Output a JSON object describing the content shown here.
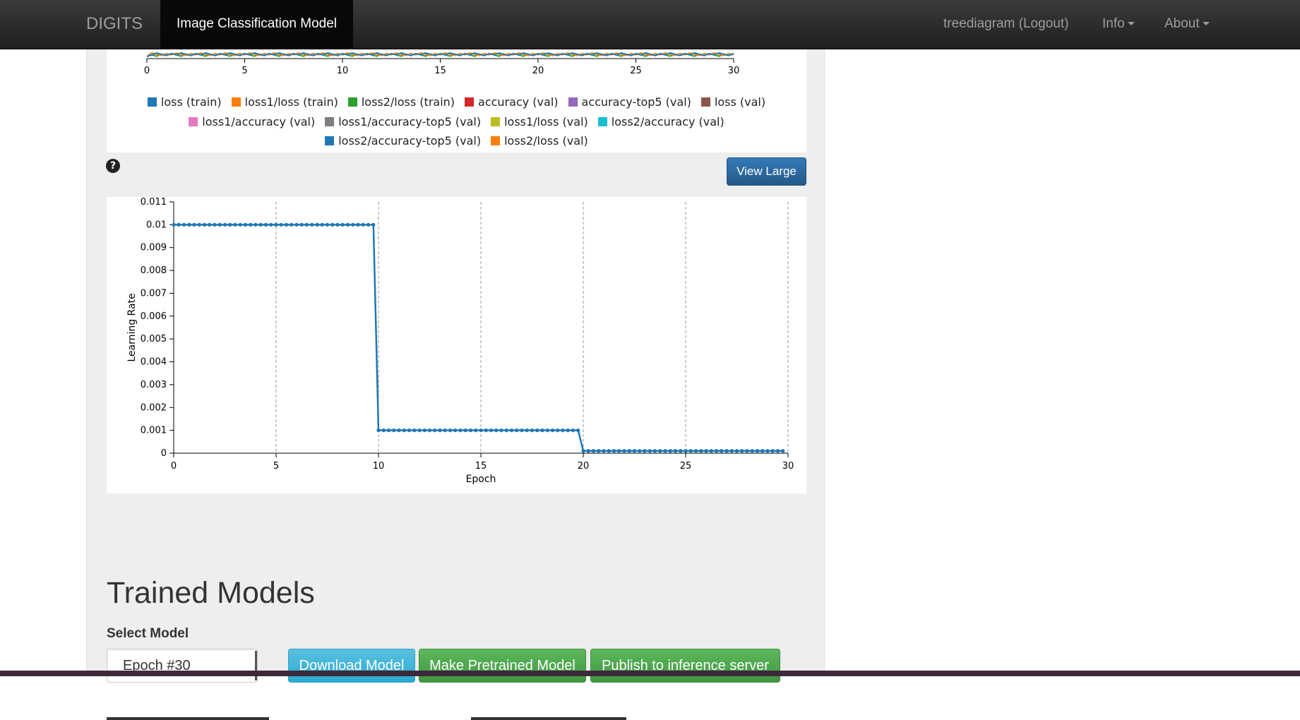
{
  "navbar": {
    "brand": "DIGITS",
    "active_tab": "Image Classification Model",
    "user": "treediagram (Logout)",
    "info": "Info",
    "about": "About"
  },
  "legend": {
    "items": [
      {
        "label": "loss (train)",
        "color": "#1f77b4"
      },
      {
        "label": "loss1/loss (train)",
        "color": "#ff7f0e"
      },
      {
        "label": "loss2/loss (train)",
        "color": "#2ca02c"
      },
      {
        "label": "accuracy (val)",
        "color": "#d62728"
      },
      {
        "label": "accuracy-top5 (val)",
        "color": "#9467bd"
      },
      {
        "label": "loss (val)",
        "color": "#8c564b"
      },
      {
        "label": "loss1/accuracy (val)",
        "color": "#e377c2"
      },
      {
        "label": "loss1/accuracy-top5 (val)",
        "color": "#7f7f7f"
      },
      {
        "label": "loss1/loss (val)",
        "color": "#bcbd22"
      },
      {
        "label": "loss2/accuracy (val)",
        "color": "#17becf"
      },
      {
        "label": "loss2/accuracy-top5 (val)",
        "color": "#1f77b4"
      },
      {
        "label": "loss2/loss (val)",
        "color": "#ff7f0e"
      }
    ]
  },
  "top_chart": {
    "x_ticks": [
      "0",
      "5",
      "10",
      "15",
      "20",
      "25",
      "30"
    ]
  },
  "help_icon": "?",
  "view_large_label": "View Large",
  "chart_data": {
    "type": "line",
    "xlabel": "Epoch",
    "ylabel": "Learning Rate",
    "xlim": [
      0,
      30
    ],
    "ylim": [
      0,
      0.011
    ],
    "x_ticks": [
      "0",
      "5",
      "10",
      "15",
      "20",
      "25",
      "30"
    ],
    "y_ticks": [
      "0",
      "0.001",
      "0.002",
      "0.003",
      "0.004",
      "0.005",
      "0.006",
      "0.007",
      "0.008",
      "0.009",
      "0.01",
      "0.011"
    ],
    "grid": "vertical dashed",
    "series": [
      {
        "color": "#1f77b4",
        "segments": [
          {
            "x_start": 0,
            "x_end": 9.75,
            "y": 0.01
          },
          {
            "x_start": 10,
            "x_end": 19.75,
            "y": 0.001
          },
          {
            "x_start": 20,
            "x_end": 29.75,
            "y": 0.0001
          }
        ],
        "points_per_epoch": 4
      }
    ]
  },
  "trained_models": {
    "title": "Trained Models",
    "select_label": "Select Model",
    "selected_model": "Epoch #30",
    "download_label": "Download Model",
    "pretrained_label": "Make Pretrained Model",
    "publish_label": "Publish to inference server"
  }
}
